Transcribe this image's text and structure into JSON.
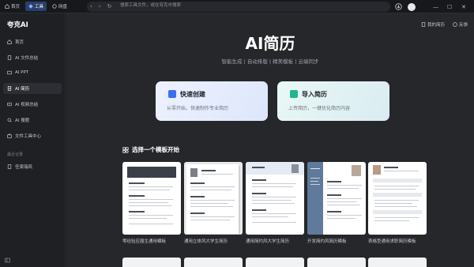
{
  "topbar": {
    "tabs": [
      {
        "label": "首页",
        "icon": "home-icon"
      },
      {
        "label": "工具",
        "icon": "tools-icon"
      },
      {
        "label": "网盘",
        "icon": "cloud-drive-icon"
      }
    ],
    "address_placeholder": "搜索工具文件，或在夸克中搜索"
  },
  "sidebar": {
    "brand": "夸克AI",
    "items": [
      {
        "label": "首页",
        "icon": "home-icon"
      },
      {
        "label": "AI 文件总结",
        "icon": "file-summary-icon"
      },
      {
        "label": "AI PPT",
        "icon": "ppt-icon"
      },
      {
        "label": "AI 简历",
        "icon": "resume-icon"
      },
      {
        "label": "AI 视频总结",
        "icon": "video-summary-icon"
      },
      {
        "label": "AI 搜题",
        "icon": "search-question-icon"
      },
      {
        "label": "文件工具中心",
        "icon": "toolbox-icon"
      }
    ],
    "recent_title": "最近记录",
    "recent_items": [
      {
        "label": "任梁瑞风",
        "icon": "record-icon"
      }
    ]
  },
  "main": {
    "links": {
      "my_resume": "我的简历",
      "feedback": "反馈"
    },
    "title": "AI简历",
    "subtitle": "智能生成 | 自动排版 | 精美模板 | 云端同步",
    "cards": [
      {
        "title": "快速创建",
        "desc": "从零开始，快速制作专业简历",
        "color": "#3b6cf5"
      },
      {
        "title": "导入简历",
        "desc": "上传简历，一键优化简历内容",
        "color": "#1fb58e"
      }
    ],
    "section_title": "选择一个模板开始",
    "templates": [
      {
        "label": "零经验应届生通用模板"
      },
      {
        "label": "通用立体风大学生简历"
      },
      {
        "label": "通用简约风大学生简历"
      },
      {
        "label": "开发简约风简历模板"
      },
      {
        "label": "表格型通用求职简历模板"
      }
    ]
  },
  "colors": {
    "accent": "#2a3f6e",
    "background": "#25272b",
    "sidebar": "#1f2024"
  }
}
